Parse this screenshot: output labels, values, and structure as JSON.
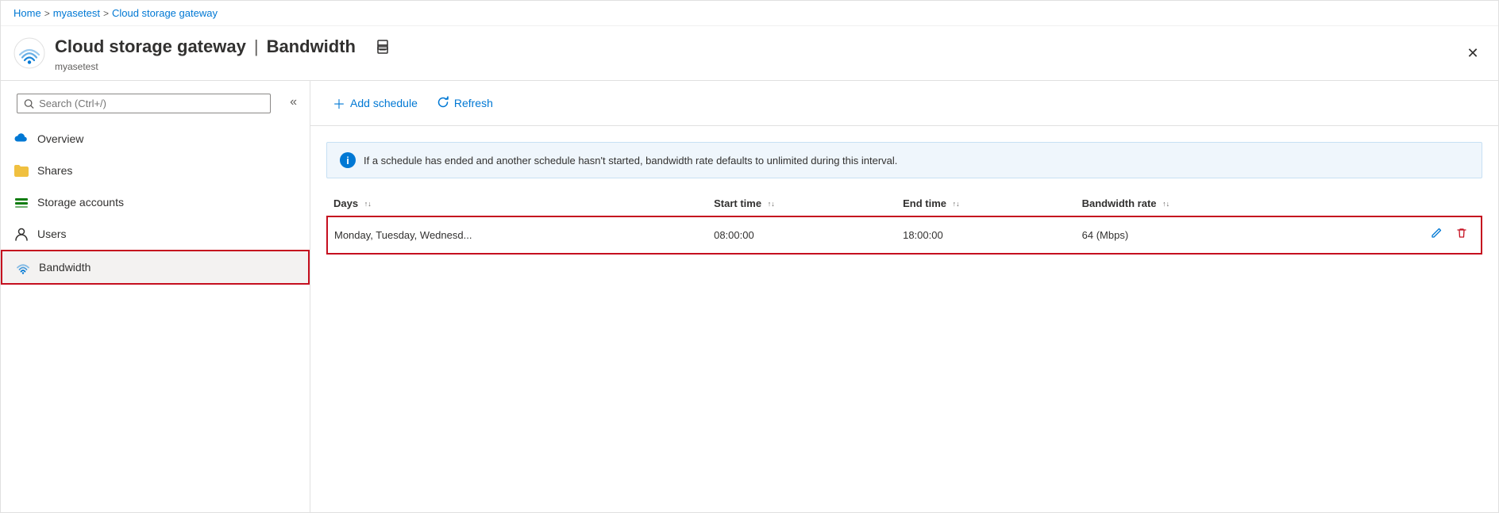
{
  "breadcrumb": {
    "items": [
      "Home",
      "myasetest",
      "Cloud storage gateway"
    ],
    "separators": [
      ">",
      ">"
    ]
  },
  "header": {
    "title": "Cloud storage gateway",
    "section": "Bandwidth",
    "subtitle": "myasetest",
    "print_icon": "⊞",
    "close_icon": "✕"
  },
  "sidebar": {
    "search_placeholder": "Search (Ctrl+/)",
    "collapse_icon": "«",
    "nav_items": [
      {
        "id": "overview",
        "label": "Overview",
        "icon": "cloud"
      },
      {
        "id": "shares",
        "label": "Shares",
        "icon": "folder"
      },
      {
        "id": "storage-accounts",
        "label": "Storage accounts",
        "icon": "storage"
      },
      {
        "id": "users",
        "label": "Users",
        "icon": "person"
      },
      {
        "id": "bandwidth",
        "label": "Bandwidth",
        "icon": "wifi",
        "active": true
      }
    ]
  },
  "toolbar": {
    "add_schedule_label": "Add schedule",
    "refresh_label": "Refresh"
  },
  "info_banner": {
    "text": "If a schedule has ended and another schedule hasn't started, bandwidth rate defaults to unlimited during this interval."
  },
  "table": {
    "columns": [
      {
        "id": "days",
        "label": "Days"
      },
      {
        "id": "start_time",
        "label": "Start time"
      },
      {
        "id": "end_time",
        "label": "End time"
      },
      {
        "id": "bandwidth_rate",
        "label": "Bandwidth rate"
      }
    ],
    "rows": [
      {
        "days": "Monday, Tuesday, Wednesd...",
        "start_time": "08:00:00",
        "end_time": "18:00:00",
        "bandwidth_rate": "64 (Mbps)"
      }
    ]
  }
}
